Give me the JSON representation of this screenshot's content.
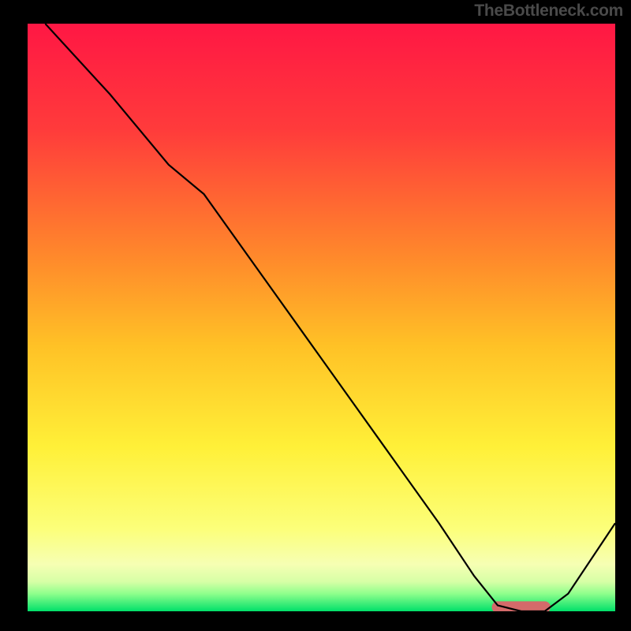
{
  "attribution": "TheBottleneck.com",
  "chart_data": {
    "type": "line",
    "title": "",
    "xlabel": "",
    "ylabel": "",
    "xlim": [
      0,
      100
    ],
    "ylim": [
      0,
      100
    ],
    "grid": false,
    "legend": false,
    "background": {
      "type": "vertical-gradient",
      "stops": [
        {
          "pos": 0.0,
          "color": "#ff1744"
        },
        {
          "pos": 0.18,
          "color": "#ff3b3b"
        },
        {
          "pos": 0.4,
          "color": "#ff8a2b"
        },
        {
          "pos": 0.55,
          "color": "#ffc226"
        },
        {
          "pos": 0.72,
          "color": "#fff038"
        },
        {
          "pos": 0.86,
          "color": "#fcff7a"
        },
        {
          "pos": 0.92,
          "color": "#f6ffb3"
        },
        {
          "pos": 0.95,
          "color": "#d6ffa6"
        },
        {
          "pos": 0.97,
          "color": "#8fff8c"
        },
        {
          "pos": 1.0,
          "color": "#00e06a"
        }
      ]
    },
    "series": [
      {
        "name": "curve",
        "color": "#000000",
        "stroke_width": 2.2,
        "x": [
          3,
          14,
          24,
          30,
          40,
          50,
          60,
          70,
          76,
          80,
          84,
          88,
          92,
          100
        ],
        "y": [
          100,
          88,
          76,
          71,
          57,
          43,
          29,
          15,
          6,
          1,
          0,
          0,
          3,
          15
        ]
      }
    ],
    "marker": {
      "name": "optimal-range",
      "shape": "rounded-bar",
      "color": "#d46a6a",
      "x_start": 79,
      "x_end": 89,
      "y": 0.7,
      "height": 2
    }
  }
}
